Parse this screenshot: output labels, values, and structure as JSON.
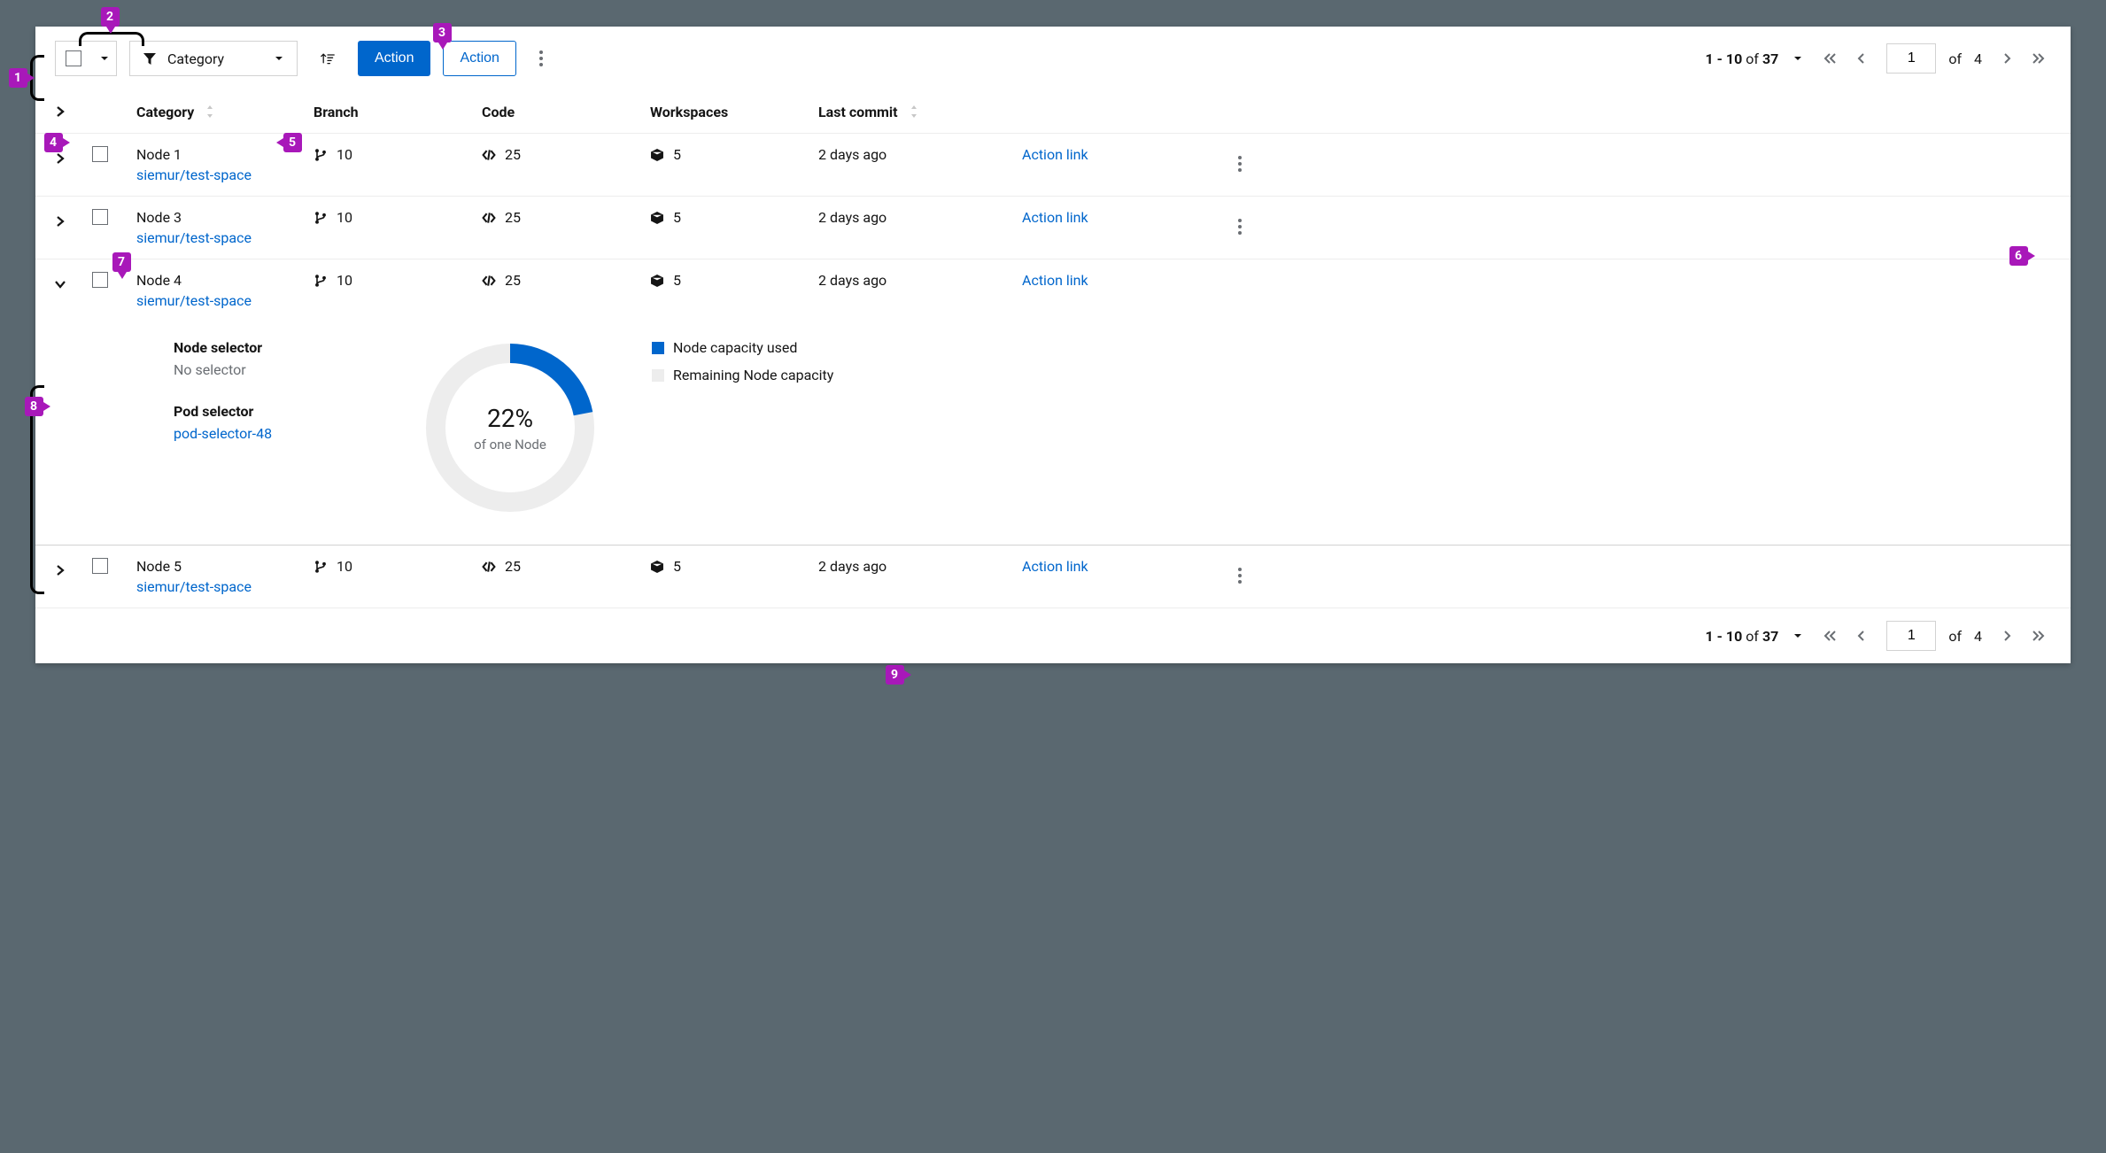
{
  "toolbar": {
    "category_label": "Category",
    "primary_action": "Action",
    "secondary_action": "Action"
  },
  "pagination_top": {
    "range": "1 - 10",
    "of_word": "of",
    "total": "37",
    "page_value": "1",
    "page_of_word": "of",
    "page_total": "4"
  },
  "pagination_bottom": {
    "range": "1 - 10",
    "of_word": "of",
    "total": "37",
    "page_value": "1",
    "page_of_word": "of",
    "page_total": "4"
  },
  "columns": {
    "category": "Category",
    "branch": "Branch",
    "code": "Code",
    "workspaces": "Workspaces",
    "last_commit": "Last commit"
  },
  "rows": [
    {
      "name": "Node 1",
      "subspace": "siemur/test-space",
      "branch": "10",
      "code": "25",
      "workspaces": "5",
      "last_commit": "2 days ago",
      "action": "Action link"
    },
    {
      "name": "Node 3",
      "subspace": "siemur/test-space",
      "branch": "10",
      "code": "25",
      "workspaces": "5",
      "last_commit": "2 days ago",
      "action": "Action link"
    },
    {
      "name": "Node 4",
      "subspace": "siemur/test-space",
      "branch": "10",
      "code": "25",
      "workspaces": "5",
      "last_commit": "2 days ago",
      "action": "Action link"
    },
    {
      "name": "Node 5",
      "subspace": "siemur/test-space",
      "branch": "10",
      "code": "25",
      "workspaces": "5",
      "last_commit": "2 days ago",
      "action": "Action link"
    }
  ],
  "detail": {
    "node_selector_label": "Node selector",
    "node_selector_value": "No selector",
    "pod_selector_label": "Pod selector",
    "pod_selector_value": "pod-selector-48",
    "donut_pct": "22%",
    "donut_sub": "of one Node",
    "legend_used": "Node capacity used",
    "legend_remaining": "Remaining Node capacity"
  },
  "chart_data": {
    "type": "pie",
    "title": "",
    "series": [
      {
        "name": "Node capacity used",
        "value": 22,
        "color": "#0066cc"
      },
      {
        "name": "Remaining Node capacity",
        "value": 78,
        "color": "#ededed"
      }
    ],
    "center_label": "22%",
    "center_sublabel": "of one Node"
  },
  "markers": {
    "m1": "1",
    "m2": "2",
    "m3": "3",
    "m4": "4",
    "m5": "5",
    "m6": "6",
    "m7": "7",
    "m8": "8",
    "m9": "9"
  }
}
